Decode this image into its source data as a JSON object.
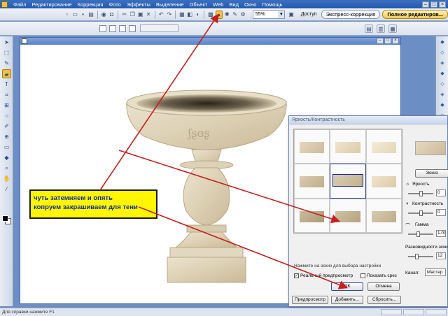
{
  "menu": {
    "items": [
      "Файл",
      "Редактирование",
      "Коррекция",
      "Фото",
      "Эффекты",
      "Выделение",
      "Объект",
      "Web",
      "Вид",
      "Окно",
      "Помощь"
    ]
  },
  "toolbar": {
    "zoom_value": "55%",
    "access_label": "Доступ",
    "express_tab": "Экспресс-коррекция",
    "full_editor_tab": "Полное редактиров..."
  },
  "annotation": {
    "line1": "чуть затемняем и опять",
    "line2": "копруем закрашиваем для тени"
  },
  "dialog": {
    "title": "Яркость/Контрастность",
    "sketch_button": "Эскиз",
    "brightness_label": "Яркость",
    "brightness_value": "0",
    "contrast_label": "Контрастность",
    "contrast_value": "0",
    "gamma_label": "Гамма",
    "gamma_value": "1.00",
    "sketch_diff_label": "Разновидности эски",
    "sketch_diff_value": "12",
    "channel_label": "Канал:",
    "channel_value": "Мастер",
    "hint": "Нажмите на эскиз для выбора настройки",
    "realtime_preview": "Реальный предпросмотр",
    "show_slice": "Показать срез",
    "ok_label": "OK",
    "cancel_label": "Отмена",
    "preview_label": "Предпросмотр",
    "add_label": "Добавить...",
    "reset_label": "Сбросить..."
  },
  "status": {
    "text": "Для справки нажмите F1"
  },
  "colors": {
    "annotation_bg": "#fff600",
    "annotation_text": "#0c2aa8",
    "arrow": "#c81e1e",
    "active_tool": "#f2c040"
  }
}
